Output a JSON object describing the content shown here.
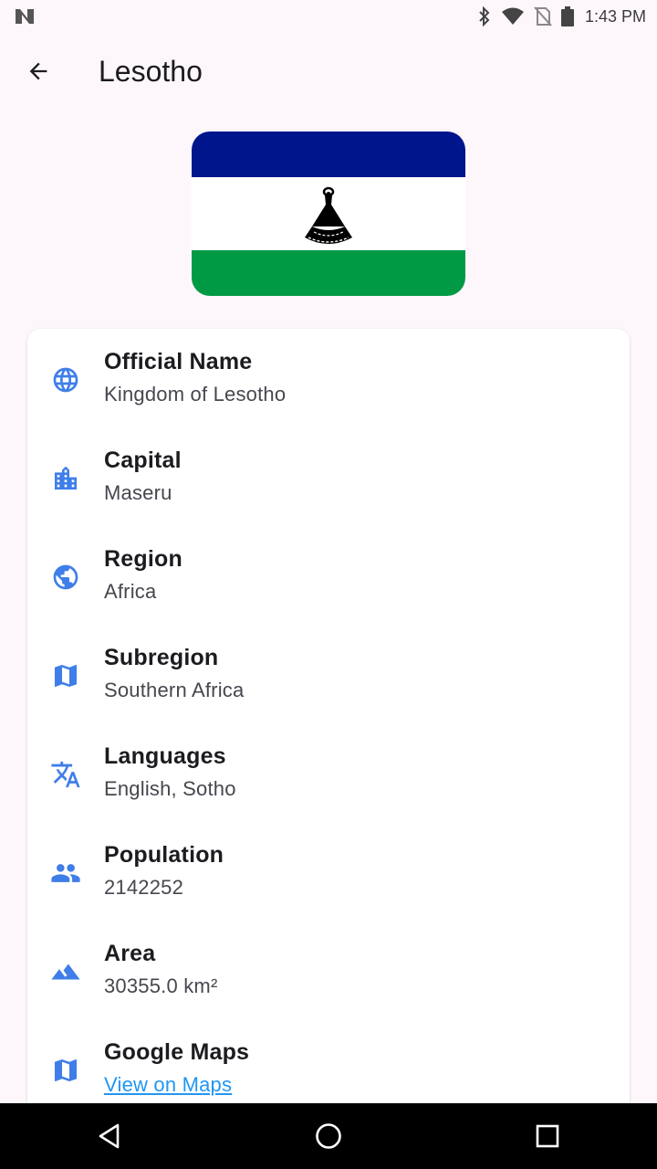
{
  "status_bar": {
    "time": "1:43 PM",
    "icons": [
      "notification-n-icon",
      "bluetooth-icon",
      "wifi-icon",
      "no-sim-icon",
      "battery-icon"
    ]
  },
  "app_bar": {
    "title": "Lesotho",
    "back_icon": "arrow-back-icon"
  },
  "flag": {
    "colors": [
      "#00148b",
      "#ffffff",
      "#009a44"
    ],
    "emblem": "mokorotlo-hat"
  },
  "details": {
    "accent_color": "#3f7ee8",
    "items": [
      {
        "label": "Official Name",
        "value": "Kingdom of Lesotho",
        "icon": "globe-icon"
      },
      {
        "label": "Capital",
        "value": "Maseru",
        "icon": "city-icon"
      },
      {
        "label": "Region",
        "value": "Africa",
        "icon": "public-globe-icon"
      },
      {
        "label": "Subregion",
        "value": "Southern Africa",
        "icon": "map-icon"
      },
      {
        "label": "Languages",
        "value": "English, Sotho",
        "icon": "translate-icon"
      },
      {
        "label": "Population",
        "value": "2142252",
        "icon": "people-icon"
      },
      {
        "label": "Area",
        "value": "30355.0 km²",
        "icon": "terrain-icon"
      },
      {
        "label": "Google Maps",
        "value": "View on Maps",
        "icon": "map-icon"
      }
    ]
  },
  "nav_bar": {
    "buttons": [
      "back-triangle-icon",
      "home-circle-icon",
      "recents-square-icon"
    ]
  }
}
